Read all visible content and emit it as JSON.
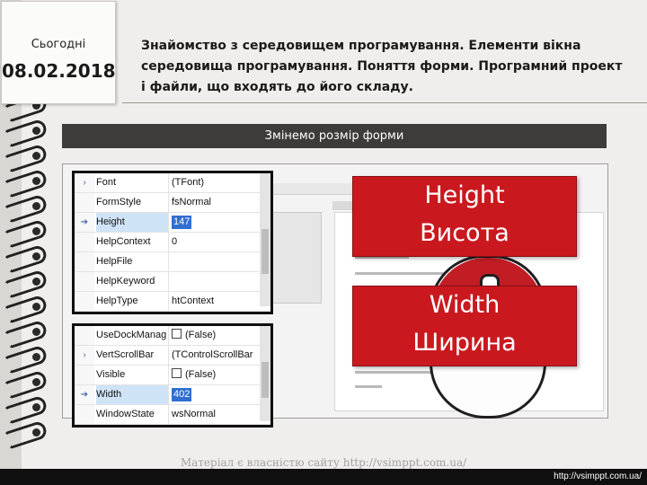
{
  "date_card": {
    "label": "Сьогодні",
    "date": "08.02.2018"
  },
  "heading": "Знайомство з середовищем програмування. Елементи вікна середовища програмування. Поняття форми. Програмний проект і файли, що входять до його складу.",
  "banner": "Змінемо розмір форми",
  "property_panel_top": {
    "rows": [
      {
        "marker": "›",
        "name": "Font",
        "value": "(TFont)",
        "selected": false,
        "edit": false
      },
      {
        "marker": "",
        "name": "FormStyle",
        "value": "fsNormal",
        "selected": false,
        "edit": false
      },
      {
        "marker": "➔",
        "name": "Height",
        "value": "147",
        "selected": true,
        "edit": true
      },
      {
        "marker": "",
        "name": "HelpContext",
        "value": "0",
        "selected": false,
        "edit": false
      },
      {
        "marker": "",
        "name": "HelpFile",
        "value": "",
        "selected": false,
        "edit": false
      },
      {
        "marker": "",
        "name": "HelpKeyword",
        "value": "",
        "selected": false,
        "edit": false
      },
      {
        "marker": "",
        "name": "HelpType",
        "value": "htContext",
        "selected": false,
        "edit": false
      }
    ]
  },
  "property_panel_bottom": {
    "rows": [
      {
        "marker": "",
        "name": "UseDockManag",
        "value": "(False)",
        "checkbox": true,
        "selected": false,
        "edit": false
      },
      {
        "marker": "›",
        "name": "VertScrollBar",
        "value": "(TControlScrollBar",
        "checkbox": false,
        "selected": false,
        "edit": false
      },
      {
        "marker": "",
        "name": "Visible",
        "value": "(False)",
        "checkbox": true,
        "selected": false,
        "edit": false
      },
      {
        "marker": "➔",
        "name": "Width",
        "value": "402",
        "checkbox": false,
        "selected": true,
        "edit": true
      },
      {
        "marker": "",
        "name": "WindowState",
        "value": "wsNormal",
        "checkbox": false,
        "selected": false,
        "edit": false
      }
    ]
  },
  "callouts": {
    "height": {
      "line1": "Height",
      "line2": "Висота"
    },
    "width": {
      "line1": "Width",
      "line2": "Ширина"
    }
  },
  "footer": {
    "note": "Матеріал є власністю сайту http://vsimppt.com.ua/",
    "url": "http://vsimppt.com.ua/"
  },
  "colors": {
    "callout": "#c9191f",
    "banner": "#3e3c3a",
    "selection": "#2f6fd0"
  }
}
